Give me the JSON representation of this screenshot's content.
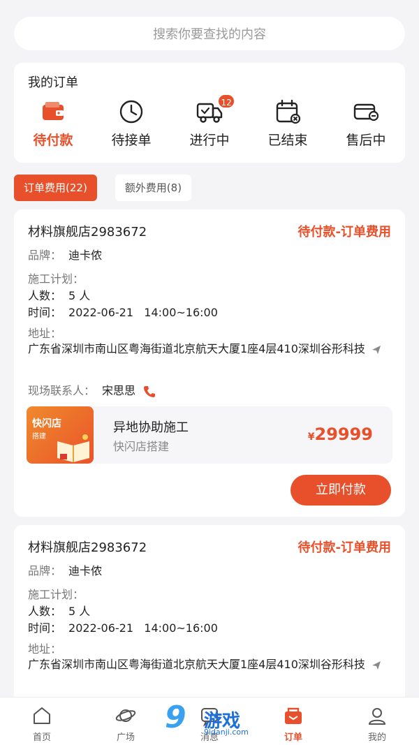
{
  "search": {
    "placeholder": "搜索你要查找的内容"
  },
  "orders": {
    "title": "我的订单",
    "tabs": [
      {
        "label": "待付款",
        "icon": "wallet-icon",
        "active": true
      },
      {
        "label": "待接单",
        "icon": "clock-icon"
      },
      {
        "label": "进行中",
        "icon": "truck-icon",
        "badge": "12"
      },
      {
        "label": "已结束",
        "icon": "calendar-x-icon"
      },
      {
        "label": "售后中",
        "icon": "refund-icon"
      }
    ]
  },
  "fee_tabs": [
    {
      "label": "订单费用(22)",
      "active": true
    },
    {
      "label": "额外费用(8)",
      "active": false
    }
  ],
  "card1": {
    "shop": "材料旗舰店2983672",
    "status": "待付款-订单费用",
    "brand_label": "品牌：",
    "brand_value": "迪卡侬",
    "plan_label": "施工计划：",
    "people_label": "人数：",
    "people_value": "5 人",
    "time_label": "时间：",
    "time_value": "2022-06-21   14:00~16:00",
    "address_label": "地址：",
    "address": "广东省深圳市南山区粤海街道北京航天大厦1座4层410深圳谷形科技",
    "contact_label": "现场联系人：",
    "contact_name": "宋思思",
    "service": {
      "thumb_title": "快闪店",
      "thumb_sub": "搭建",
      "name": "异地协助施工",
      "sub": "快闪店搭建",
      "currency": "¥",
      "price": "29999"
    },
    "pay_button": "立即付款"
  },
  "card2": {
    "shop": "材料旗舰店2983672",
    "status": "待付款-订单费用",
    "brand_label": "品牌：",
    "brand_value": "迪卡侬",
    "plan_label": "施工计划：",
    "people_label": "人数：",
    "people_value": "5 人",
    "time_label": "时间：",
    "time_value": "2022-06-21   14:00~16:00",
    "address_label": "地址：",
    "address": "广东省深圳市南山区粤海街道北京航天大厦1座4层410深圳谷形科技"
  },
  "tabbar": [
    {
      "label": "首页",
      "icon": "home-icon"
    },
    {
      "label": "广场",
      "icon": "planet-icon"
    },
    {
      "label": "消息",
      "icon": "message-icon"
    },
    {
      "label": "订单",
      "icon": "order-icon",
      "active": true
    },
    {
      "label": "我的",
      "icon": "profile-icon"
    }
  ],
  "watermark": {
    "num": "9",
    "text": "游戏",
    "url": "9idanji.com"
  },
  "colors": {
    "accent": "#e8502b",
    "background": "#f4f4f6"
  }
}
